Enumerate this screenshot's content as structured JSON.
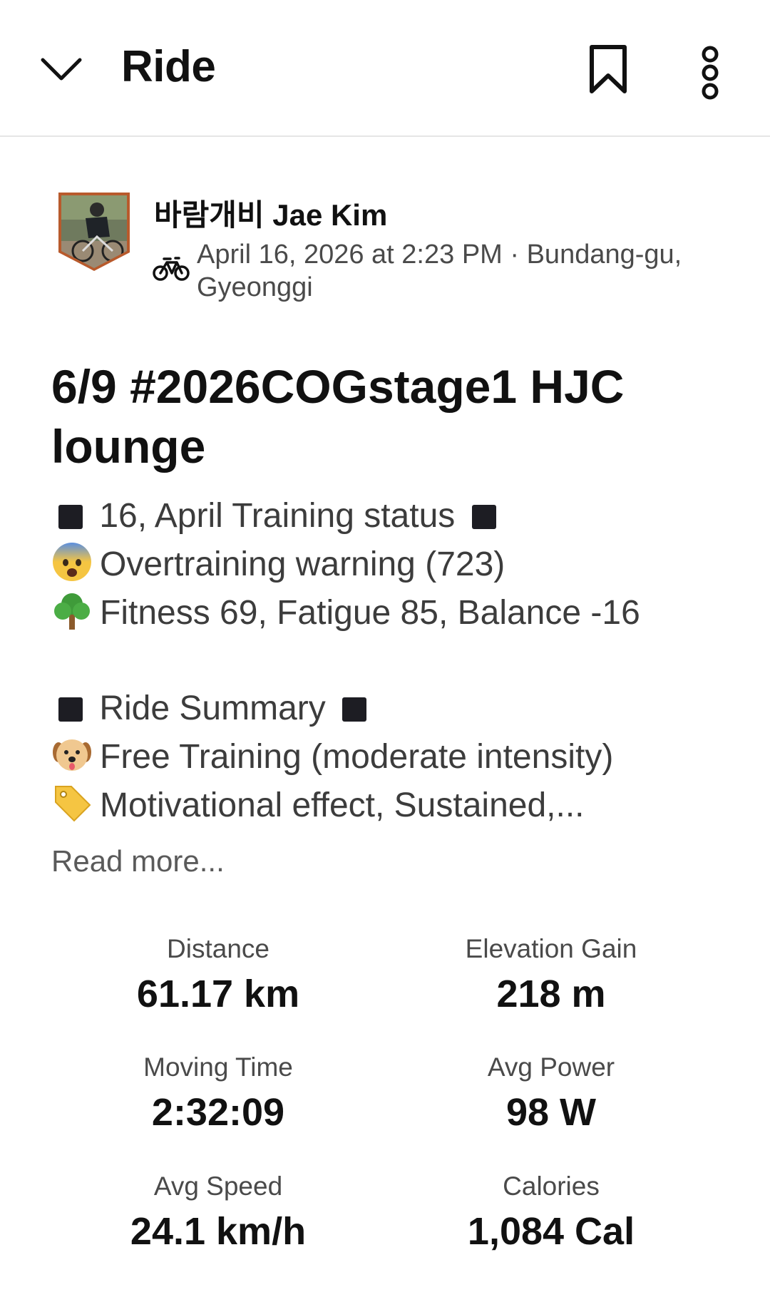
{
  "header": {
    "title": "Ride",
    "back_icon": "chevron-down-icon",
    "bookmark_icon": "bookmark-icon",
    "more_icon": "more-vertical-icon"
  },
  "athlete": {
    "name": "바람개비 Jae Kim",
    "meta": "April 16, 2026 at 2:23 PM · Bundang-gu, Gyeonggi",
    "sport_icon": "bicycle-icon"
  },
  "activity": {
    "title": "6/9 #2026COGstage1 HJC lounge"
  },
  "description": {
    "line1": "16, April Training status",
    "line2": "Overtraining warning (723)",
    "line3": "Fitness 69, Fatigue 85, Balance -16",
    "line4": "Ride Summary",
    "line5": "Free Training (moderate intensity)",
    "line6": "Motivational effect, Sustained,...",
    "read_more": "Read more..."
  },
  "stats": [
    {
      "label": "Distance",
      "value": "61.17 km"
    },
    {
      "label": "Elevation Gain",
      "value": "218 m"
    },
    {
      "label": "Moving Time",
      "value": "2:32:09"
    },
    {
      "label": "Avg Power",
      "value": "98 W"
    },
    {
      "label": "Avg Speed",
      "value": "24.1 km/h"
    },
    {
      "label": "Calories",
      "value": "1,084 Cal"
    }
  ],
  "colors": {
    "text_primary": "#111111",
    "text_secondary": "#4a4a4a",
    "divider": "#e6e6e6",
    "avatar_border": "#b85a2c"
  }
}
